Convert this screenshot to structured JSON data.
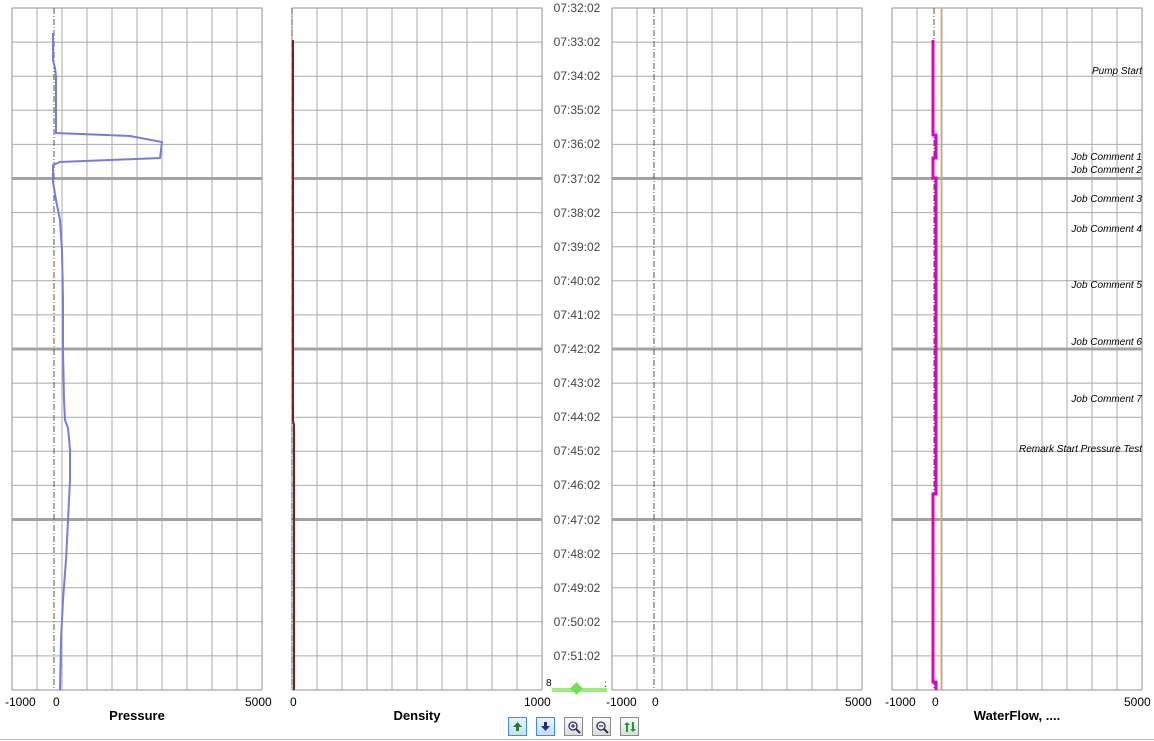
{
  "tracks": [
    {
      "title": "Pressure",
      "axis_min": "-1000",
      "axis_zero": "0",
      "axis_max": "5000",
      "color": "#7b7bdc"
    },
    {
      "title": "Density",
      "axis_zero": "0",
      "axis_max": "1000",
      "color": "#7a1f1f"
    },
    {
      "title": "",
      "axis_min": "-1000",
      "axis_zero": "0",
      "axis_max": "5000"
    },
    {
      "title": "WaterFlow, ....",
      "axis_min": "-1000",
      "axis_zero": "0",
      "axis_max": "5000",
      "color": "#e000c0"
    }
  ],
  "time_labels": [
    "07:32:02",
    "07:33:02",
    "07:34:02",
    "07:35:02",
    "07:36:02",
    "07:37:02",
    "07:38:02",
    "07:39:02",
    "07:40:02",
    "07:41:02",
    "07:42:02",
    "07:43:02",
    "07:44:02",
    "07:45:02",
    "07:46:02",
    "07:47:02",
    "07:48:02",
    "07:49:02",
    "07:50:02",
    "07:51:02"
  ],
  "comments": [
    "Pump Start",
    "Job Comment 1",
    "Job Comment 2",
    "Job Comment 3",
    "Job Comment 4",
    "Job Comment 5",
    "Job Comment 6",
    "Job Comment 7",
    "Remark Start Pressure Test"
  ],
  "time_scroller": {
    "left_label": "8",
    "right_label": ":"
  },
  "toolbar": [
    {
      "name": "scroll-up-button",
      "icon": "arrow-up-icon",
      "active": true
    },
    {
      "name": "scroll-down-button",
      "icon": "arrow-down-icon",
      "active": true
    },
    {
      "name": "zoom-in-button",
      "icon": "zoom-in-icon",
      "active": false
    },
    {
      "name": "zoom-out-button",
      "icon": "zoom-out-icon",
      "active": false
    },
    {
      "name": "swap-button",
      "icon": "swap-icon",
      "active": false
    }
  ],
  "colors": {
    "grid": "#a9a9a9",
    "major_grid": "#a3a3a3",
    "pressure": "#7b7bdc",
    "density": "#7a1f1f",
    "waterflow": "#e000c0",
    "scroller": "#99ee77"
  }
}
